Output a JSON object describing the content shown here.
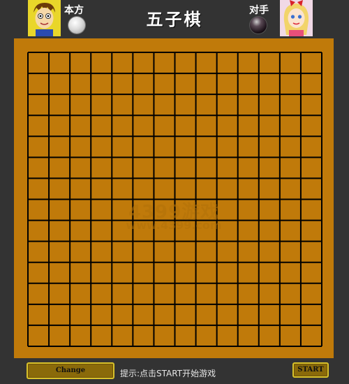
{
  "header": {
    "title": "五子棋",
    "self_label": "本方",
    "opponent_label": "对手",
    "self_avatar": "boy-avatar",
    "opponent_avatar": "girl-avatar"
  },
  "board": {
    "lines": 15,
    "watermark_main": "4399游戏",
    "watermark_url": "www.4399.com",
    "colors": {
      "wood": "#c07a0a",
      "grid": "#000000"
    }
  },
  "footer": {
    "change_label": "Change",
    "hint": "提示:点击START开始游戏",
    "start_label": "START"
  },
  "colors": {
    "background": "#333333",
    "button_border": "#d9c22a",
    "button_fill": "#8a6a0a"
  }
}
